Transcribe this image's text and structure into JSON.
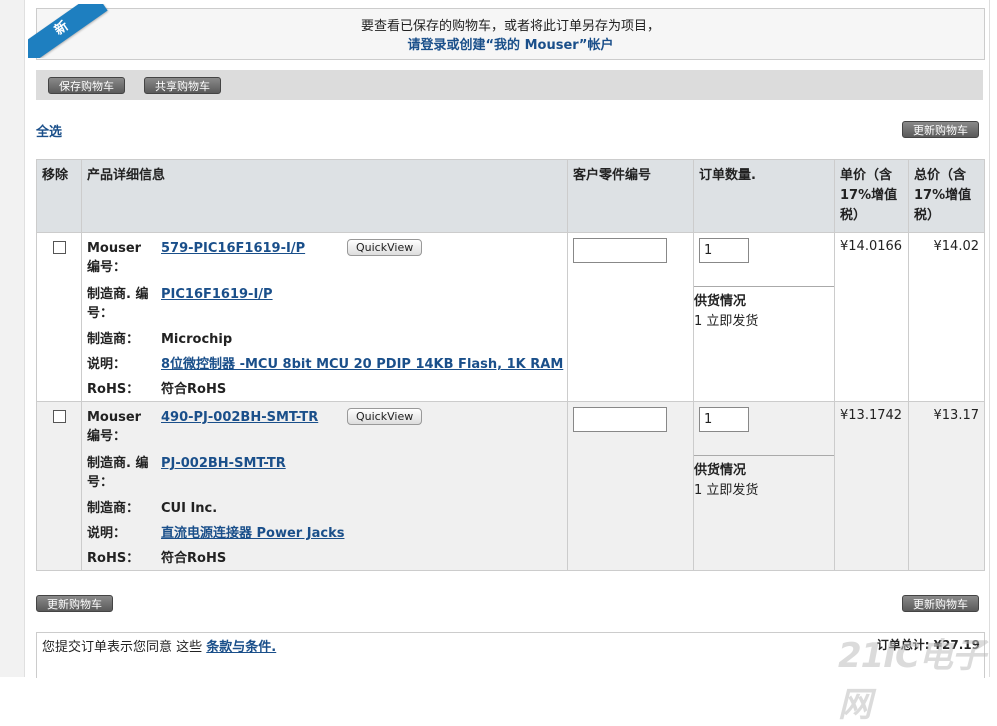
{
  "banner": {
    "badge": "新",
    "line1": "要查看已保存的购物车，或者将此订单另存为项目，",
    "line2": "请登录或创建“我的 Mouser”帐户"
  },
  "toolbar": {
    "save_cart": "保存购物车",
    "share_cart": "共享购物车"
  },
  "select_all": "全选",
  "update_cart": "更新购物车",
  "table": {
    "headers": [
      "移除",
      "产品详细信息",
      "客户零件编号",
      "订单数量.",
      "单价（含17%增值税）",
      "总价（含17%增值税）"
    ],
    "labels": {
      "mouser_no": "Mouser 编号：",
      "mfr_no": "制造商. 编号：",
      "mfr": "制造商：",
      "desc": "说明：",
      "rohs": "RoHS："
    },
    "quickview": "QuickView",
    "availability_label": "供货情况",
    "rows": [
      {
        "mouser_no": "579-PIC16F1619-I/P",
        "mfr_no": "PIC16F1619-I/P",
        "mfr": "Microchip",
        "desc": "8位微控制器 -MCU 8bit MCU 20 PDIP 14KB Flash, 1K RAM",
        "rohs": "符合RoHS",
        "qty": "1",
        "availability": "1 立即发货",
        "unit_price": "¥14.0166",
        "total_price": "¥14.02"
      },
      {
        "mouser_no": "490-PJ-002BH-SMT-TR",
        "mfr_no": "PJ-002BH-SMT-TR",
        "mfr": "CUI Inc.",
        "desc": "直流电源连接器 Power Jacks",
        "rohs": "符合RoHS",
        "qty": "1",
        "availability": "1 立即发货",
        "unit_price": "¥13.1742",
        "total_price": "¥13.17"
      }
    ]
  },
  "footer": {
    "terms_prefix": "您提交订单表示您同意 这些",
    "terms_link": "条款与条件.",
    "order_total": "订单总计: ¥27.19",
    "watermark": "21IC电子网"
  }
}
